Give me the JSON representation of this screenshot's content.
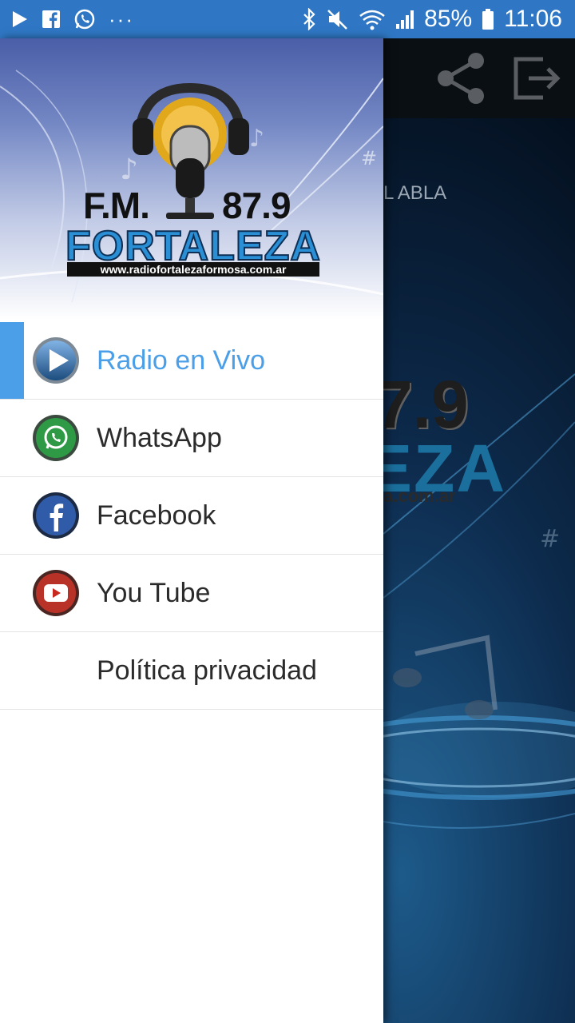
{
  "status_bar": {
    "battery": "85%",
    "time": "11:06",
    "overflow": "···",
    "left_icons": [
      "play-icon",
      "facebook-notification-icon",
      "whatsapp-notification-icon"
    ],
    "right_icons": [
      "bluetooth-icon",
      "mute-icon",
      "wifi-icon",
      "signal-icon",
      "battery-icon"
    ]
  },
  "background_app": {
    "partial_text": "L ABLA",
    "logo_number_partial": "7.9",
    "logo_word_partial": "EZA",
    "logo_url_partial": "a.com.ar",
    "toolbar_icons": [
      "share-icon",
      "exit-icon"
    ]
  },
  "drawer": {
    "header": {
      "logo_fm": "F.M.",
      "logo_frequency": "87.9",
      "logo_name": "FORTALEZA",
      "logo_url": "www.radiofortalezaformosa.com.ar"
    },
    "menu": [
      {
        "label": "Radio en Vivo",
        "icon": "play-circle-icon",
        "active": true
      },
      {
        "label": "WhatsApp",
        "icon": "whatsapp-icon",
        "active": false
      },
      {
        "label": "Facebook",
        "icon": "facebook-icon",
        "active": false
      },
      {
        "label": "You Tube",
        "icon": "youtube-icon",
        "active": false
      },
      {
        "label": "Política privacidad",
        "icon": "",
        "active": false
      }
    ]
  },
  "colors": {
    "status_bar": "#2f77c4",
    "accent": "#4a9fe8",
    "text": "#2b2b2b",
    "toolbar": "#0a0f14"
  }
}
